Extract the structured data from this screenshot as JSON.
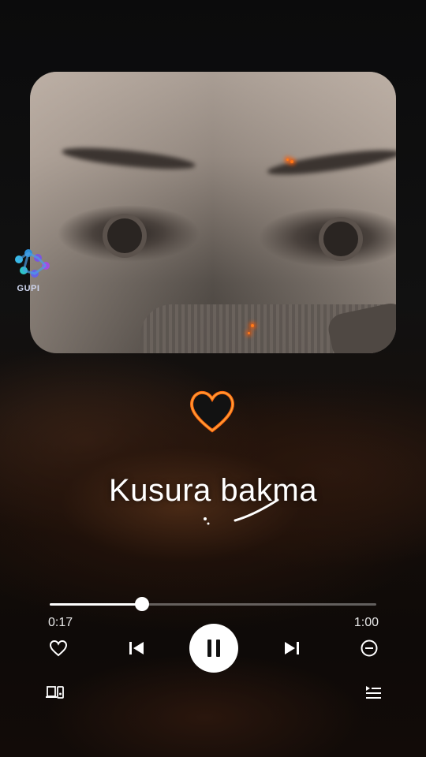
{
  "watermark": {
    "text": "GUPI",
    "icon": "gupi-logo"
  },
  "album_art": {
    "description_icon": "album-art"
  },
  "decoration": {
    "icon": "fire-heart-icon"
  },
  "song": {
    "title": "Kusura bakma"
  },
  "player": {
    "current_time": "0:17",
    "total_time": "1:00",
    "progress": 0.283,
    "accent_color": "#ffffff",
    "controls": {
      "like": "heart-icon",
      "previous": "skip-previous-icon",
      "play_pause": "pause-icon",
      "next": "skip-next-icon",
      "remove": "minus-circle-icon",
      "devices": "connect-device-icon",
      "queue": "queue-icon"
    }
  }
}
